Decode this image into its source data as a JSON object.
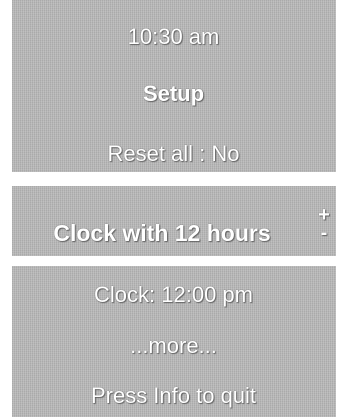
{
  "menu": {
    "time": "10:30 am",
    "title": "Setup",
    "reset_all": "Reset all : No",
    "selected_item": "Clock with 12 hours",
    "adjust_plus": "+",
    "adjust_minus": "-",
    "clock_item": "Clock: 12:00 pm",
    "more_item": "...more...",
    "quit_hint": "Press Info to quit"
  },
  "colors": {
    "panel": "#b9b9b9",
    "text": "#ffffff"
  }
}
